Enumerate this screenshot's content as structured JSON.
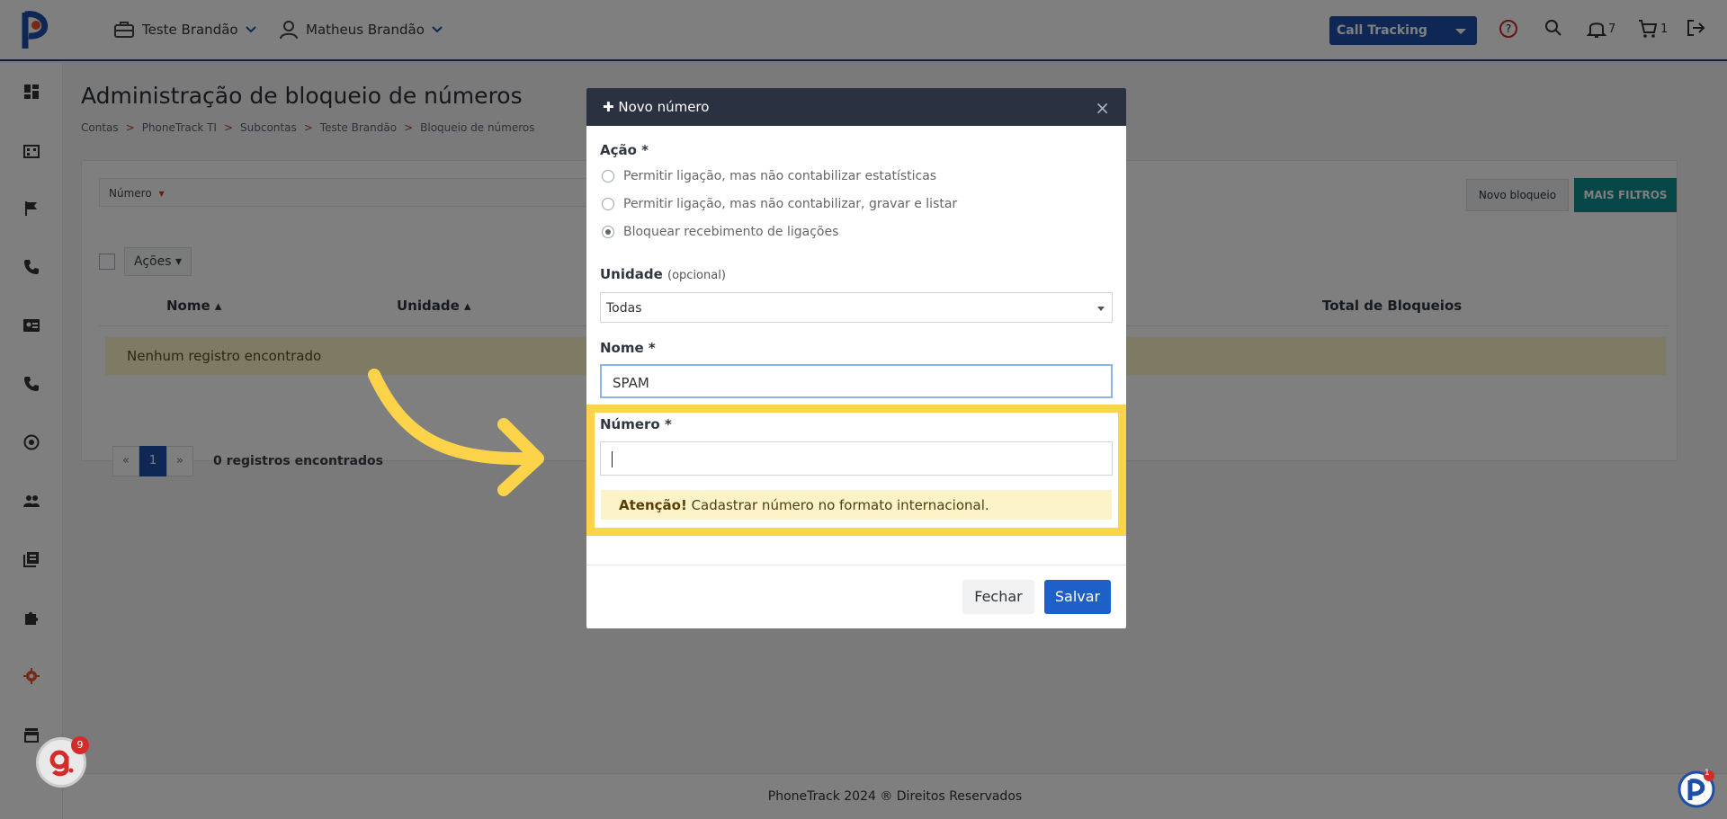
{
  "topbar": {
    "account_menu": "Teste Brandão",
    "user_menu": "Matheus Brandão",
    "product_select": "Call Tracking",
    "notifications_count": "7",
    "cart_count": "1"
  },
  "page": {
    "title": "Administração de bloqueio de números",
    "breadcrumb": [
      "Contas",
      "PhoneTrack TI",
      "Subcontas",
      "Teste Brandão",
      "Bloqueio de números"
    ]
  },
  "filters": {
    "number_label": "Número",
    "novo_bloqueio": "Novo bloqueio",
    "mais_filtros": "MAIS FILTROS"
  },
  "table": {
    "actions_label": "Ações",
    "columns": [
      "Nome",
      "Unidade",
      "Total de Bloqueios"
    ],
    "empty_message": "Nenhum registro encontrado"
  },
  "pagination": {
    "prev": "«",
    "current": "1",
    "next": "»",
    "count_text": "0 registros encontrados"
  },
  "footer": {
    "text": "PhoneTrack 2024 ® Direitos Reservados"
  },
  "modal": {
    "title": "Novo número",
    "close": "×",
    "acao_label": "Ação *",
    "options": [
      "Permitir ligação, mas não contabilizar estatísticas",
      "Permitir ligação, mas não contabilizar, gravar e listar",
      "Bloquear recebimento de ligações"
    ],
    "unidade_label": "Unidade",
    "unidade_optional": "(opcional)",
    "unidade_value": "Todas",
    "nome_label": "Nome *",
    "nome_value": "SPAM",
    "numero_label": "Número *",
    "numero_value": "",
    "alert_strong": "Atenção!",
    "alert_text": " Cadastrar número no formato internacional.",
    "btn_fechar": "Fechar",
    "btn_salvar": "Salvar"
  },
  "widgets": {
    "g_badge": "9",
    "chat_badge": "1"
  },
  "colors": {
    "highlight": "#fdd34a",
    "primary": "#1e5fc8",
    "teal": "#0c8c8c",
    "modal_header": "#2a3140"
  }
}
